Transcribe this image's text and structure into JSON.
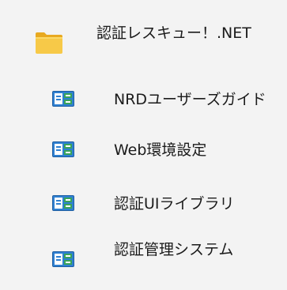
{
  "colors": {
    "background": "#f3f3f3",
    "text": "#1b1b1b",
    "folder_yellow": "#f7c948",
    "folder_back": "#e8a920",
    "app_icon_blue": "#2f80d1",
    "app_icon_green": "#3aa35a"
  },
  "folder": {
    "icon": "folder-icon",
    "label": "認証レスキュー！.NET"
  },
  "items": [
    {
      "icon": "shortcut-app-icon",
      "label": "NRDユーザーズガイド"
    },
    {
      "icon": "shortcut-app-icon",
      "label": "Web環境設定"
    },
    {
      "icon": "shortcut-app-icon",
      "label": "認証UIライブラリ"
    },
    {
      "icon": "shortcut-app-icon",
      "label": "認証管理システム"
    }
  ]
}
